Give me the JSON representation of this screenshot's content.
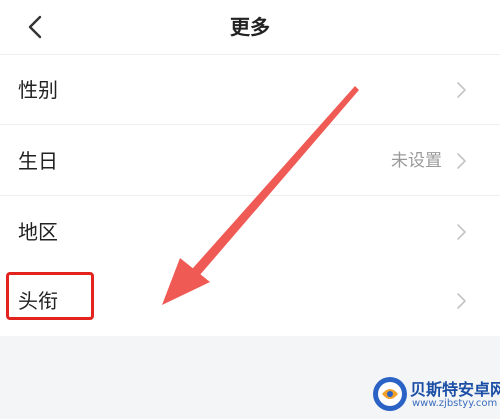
{
  "header": {
    "title": "更多",
    "back_icon": "chevron-left-icon"
  },
  "rows": [
    {
      "label": "性别",
      "value": ""
    },
    {
      "label": "生日",
      "value": "未设置"
    },
    {
      "label": "地区",
      "value": ""
    },
    {
      "label": "头衔",
      "value": ""
    }
  ],
  "row_icon": "chevron-right-icon",
  "annotation": {
    "highlight_color": "#e3231d",
    "arrow_color": "#f05a55"
  },
  "watermark": {
    "title": "贝斯特安卓网",
    "url": "www.zjbstyy.com"
  }
}
